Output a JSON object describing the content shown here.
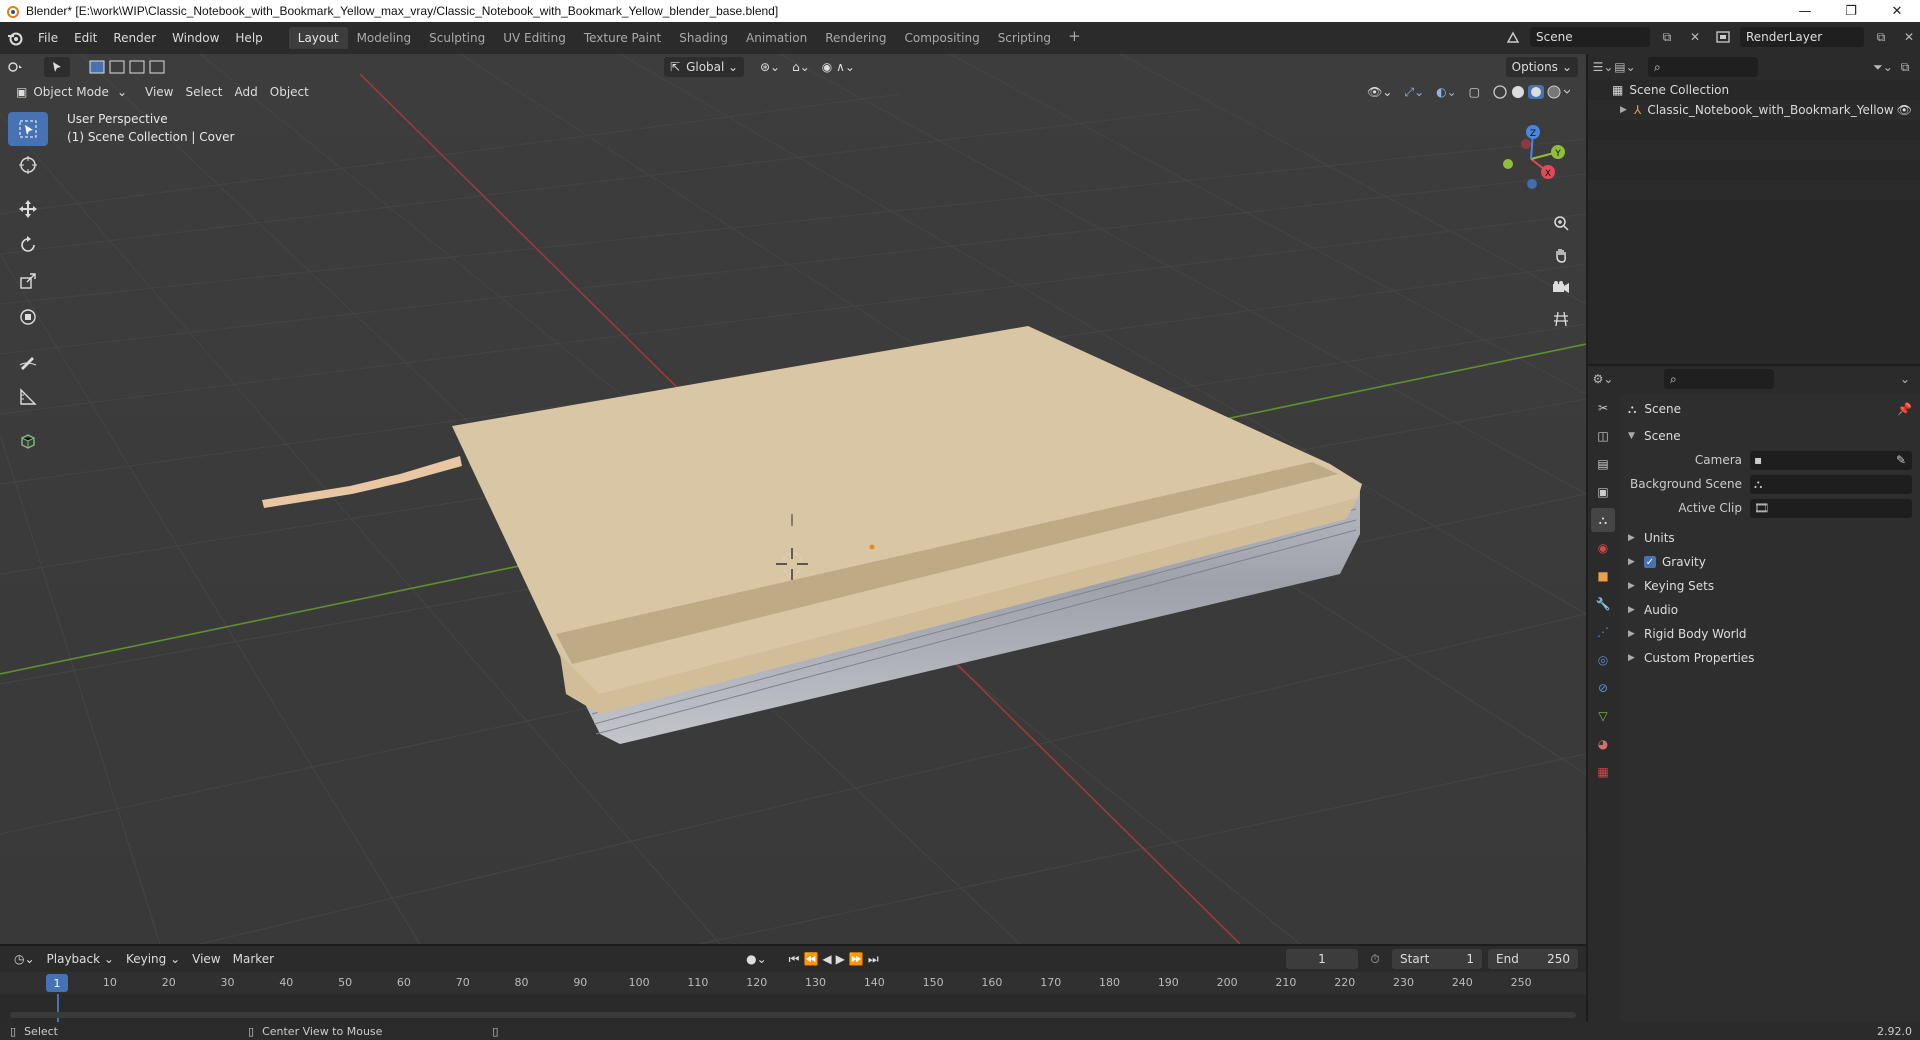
{
  "window": {
    "title": "Blender* [E:\\work\\WIP\\Classic_Notebook_with_Bookmark_Yellow_max_vray/Classic_Notebook_with_Bookmark_Yellow_blender_base.blend]",
    "min": "—",
    "max": "❐",
    "close": "✕"
  },
  "menu": [
    "File",
    "Edit",
    "Render",
    "Window",
    "Help"
  ],
  "workspaces": [
    "Layout",
    "Modeling",
    "Sculpting",
    "UV Editing",
    "Texture Paint",
    "Shading",
    "Animation",
    "Rendering",
    "Compositing",
    "Scripting"
  ],
  "active_workspace": "Layout",
  "topbar_right": {
    "scene": "Scene",
    "render_layer": "RenderLayer"
  },
  "viewport": {
    "transform_orientation": "Global",
    "options_label": "Options",
    "mode": "Object Mode",
    "menus": [
      "View",
      "Select",
      "Add",
      "Object"
    ],
    "overlay_line1": "User Perspective",
    "overlay_line2": "(1) Scene Collection | Cover",
    "gizmo": {
      "x": "X",
      "y": "Y",
      "z": "Z"
    }
  },
  "outliner": {
    "root": "Scene Collection",
    "items": [
      {
        "name": "Classic_Notebook_with_Bookmark_Yellow"
      }
    ]
  },
  "properties": {
    "context": "Scene",
    "panel": "Scene",
    "fields": [
      {
        "label": "Camera",
        "value": ""
      },
      {
        "label": "Background Scene",
        "value": ""
      },
      {
        "label": "Active Clip",
        "value": ""
      }
    ],
    "subpanels": [
      "Units",
      "Gravity",
      "Keying Sets",
      "Audio",
      "Rigid Body World",
      "Custom Properties"
    ],
    "gravity_checked": true
  },
  "timeline": {
    "menus": [
      "Playback",
      "Keying",
      "View",
      "Marker"
    ],
    "current_frame": "1",
    "start_label": "Start",
    "start": "1",
    "end_label": "End",
    "end": "250",
    "ticks": [
      "10",
      "20",
      "30",
      "40",
      "50",
      "60",
      "70",
      "80",
      "90",
      "100",
      "110",
      "120",
      "130",
      "140",
      "150",
      "160",
      "170",
      "180",
      "190",
      "200",
      "210",
      "220",
      "230",
      "240",
      "250"
    ],
    "ruler_current": "1"
  },
  "statusbar": {
    "left": "Select",
    "middle": "Center View to Mouse",
    "version": "2.92.0"
  },
  "colors": {
    "accent": "#4772b3",
    "cover": "#d9c6a5",
    "x_axis": "#b34040",
    "y_axis": "#5d9a2c"
  }
}
